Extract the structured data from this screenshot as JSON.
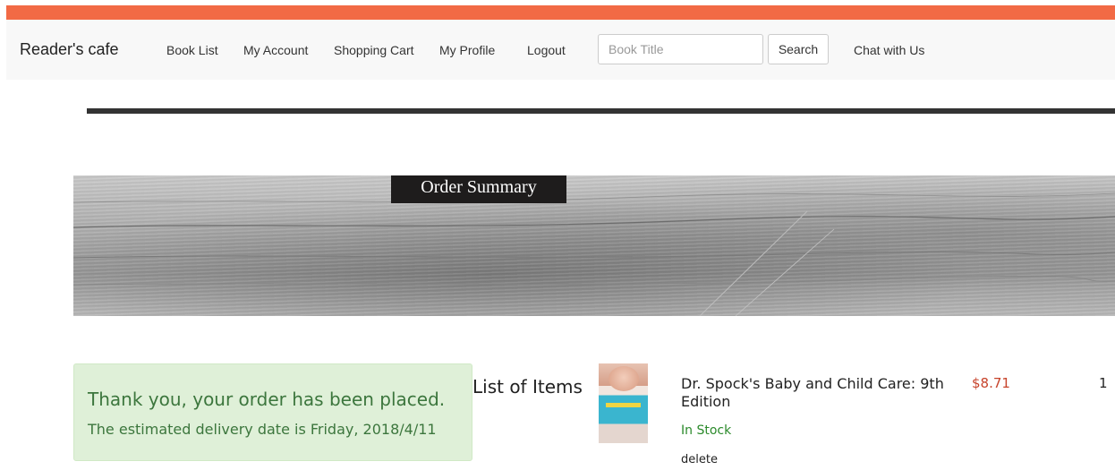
{
  "theme": {
    "accent_bar": "#f26a45",
    "navbar_bg": "#f8f8f8",
    "alert_bg": "#dff0d8",
    "alert_text": "#3c763d",
    "price_color": "#c7432b",
    "stock_color": "#2b8a2b"
  },
  "nav": {
    "brand": "Reader's cafe",
    "items": [
      {
        "label": "Book List"
      },
      {
        "label": "My Account"
      },
      {
        "label": "Shopping Cart"
      },
      {
        "label": "My Profile"
      },
      {
        "label": "Logout"
      }
    ],
    "search": {
      "placeholder": "Book Title",
      "value": "",
      "button_label": "Search"
    },
    "chat_label": "Chat with Us"
  },
  "banner": {
    "title": "Order Summary"
  },
  "confirmation": {
    "message": "Thank you, your order has been placed.",
    "delivery": "The estimated delivery date is Friday, 2018/4/11"
  },
  "items": {
    "heading": "List of Items",
    "list": [
      {
        "title": "Dr. Spock's Baby and Child Care: 9th Edition",
        "stock": "In Stock",
        "delete_label": "delete",
        "price": "$8.71",
        "quantity": "1",
        "cover_icon": "book-cover-image"
      }
    ]
  }
}
